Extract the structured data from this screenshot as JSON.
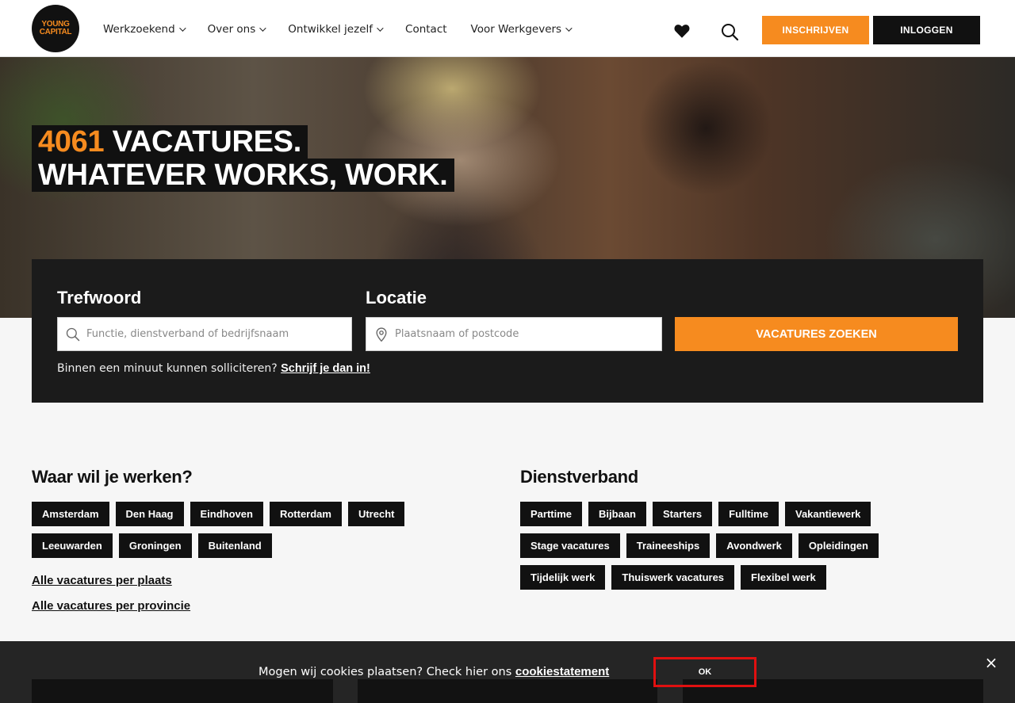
{
  "header": {
    "logo": [
      "YOUNG",
      "CAPITAL"
    ],
    "nav": [
      {
        "label": "Werkzoekend",
        "has_menu": true
      },
      {
        "label": "Over ons",
        "has_menu": true
      },
      {
        "label": "Ontwikkel jezelf",
        "has_menu": true
      },
      {
        "label": "Contact",
        "has_menu": false
      },
      {
        "label": "Voor Werkgevers",
        "has_menu": true
      }
    ],
    "signup_label": "INSCHRIJVEN",
    "login_label": "INLOGGEN"
  },
  "hero": {
    "count": "4061",
    "line1_rest": " VACATURES.",
    "line2": "WHATEVER WORKS, WORK."
  },
  "search": {
    "keyword_label": "Trefwoord",
    "keyword_placeholder": "Functie, dienstverband of bedrijfsnaam",
    "location_label": "Locatie",
    "location_placeholder": "Plaatsnaam of postcode",
    "button_label": "VACATURES ZOEKEN",
    "note_text": "Binnen een minuut kunnen solliciteren? ",
    "note_link": "Schrijf je dan in!"
  },
  "locations": {
    "title": "Waar wil je werken?",
    "tags": [
      "Amsterdam",
      "Den Haag",
      "Eindhoven",
      "Rotterdam",
      "Utrecht",
      "Leeuwarden",
      "Groningen",
      "Buitenland"
    ],
    "link_city": "Alle vacatures per plaats",
    "link_province": "Alle vacatures per provincie"
  },
  "employment": {
    "title": "Dienstverband",
    "tags": [
      "Parttime",
      "Bijbaan",
      "Starters",
      "Fulltime",
      "Vakantiewerk",
      "Stage vacatures",
      "Traineeships",
      "Avondwerk",
      "Opleidingen",
      "Tijdelijk werk",
      "Thuiswerk vacatures",
      "Flexibel werk"
    ]
  },
  "cookie": {
    "text": "Mogen wij cookies plaatsen? Check hier ons ",
    "link": "cookiestatement",
    "ok_label": "OK",
    "close_label": "×"
  },
  "colors": {
    "accent": "#f68b1f",
    "dark": "#111111",
    "highlight_border": "#e01010"
  },
  "icons": {
    "favorites": "heart-icon",
    "search": "search-icon",
    "keyword_field": "search-icon",
    "location_field": "location-pin-icon",
    "cookie_close": "close-icon"
  }
}
